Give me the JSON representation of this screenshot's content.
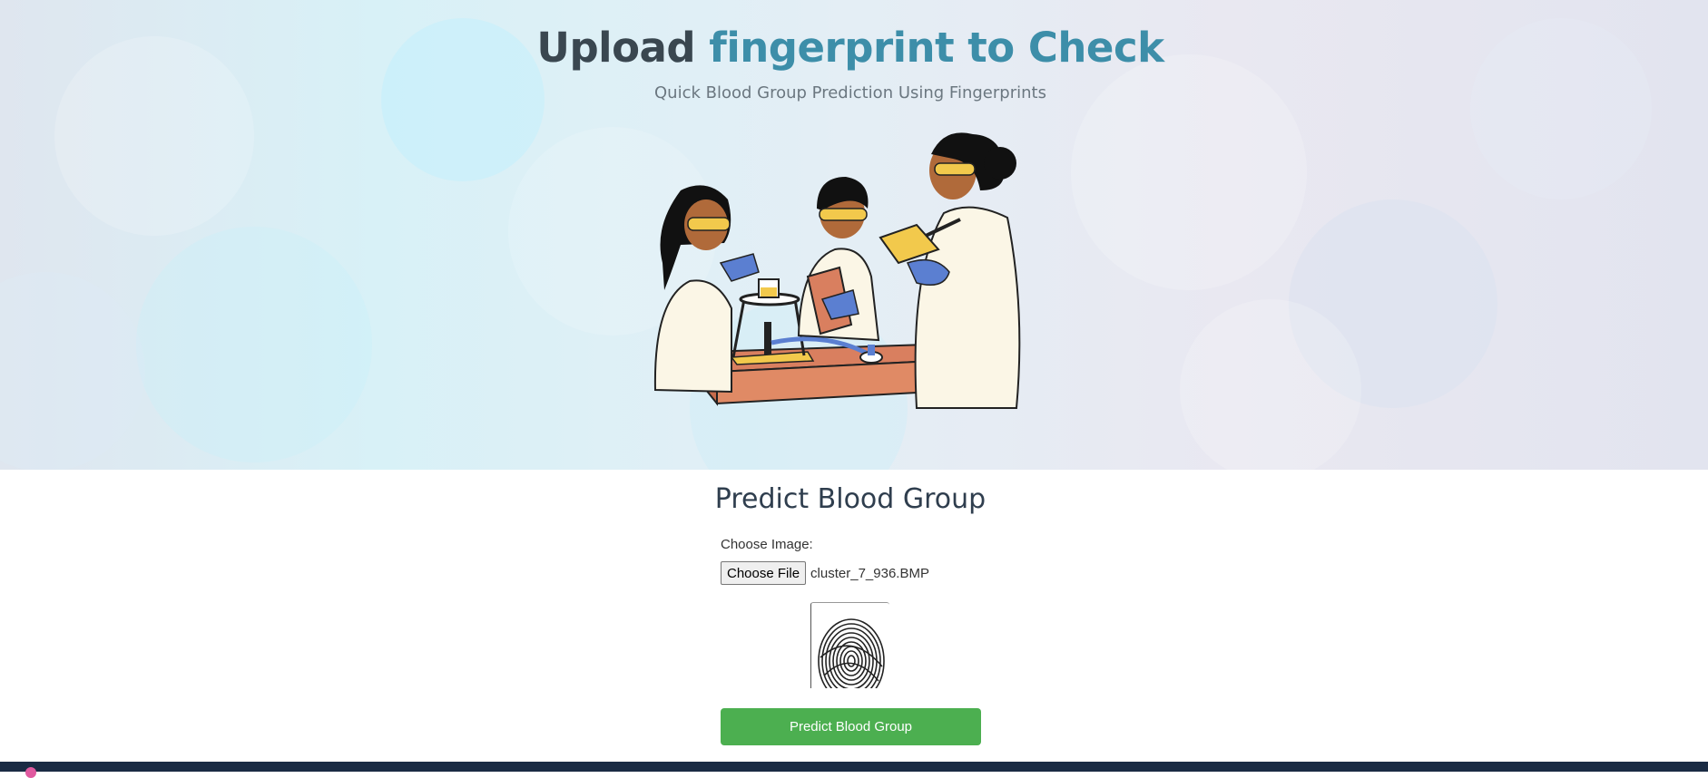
{
  "hero": {
    "title_part1": "Upload ",
    "title_part2": "fingerprint to Check",
    "subtitle": "Quick Blood Group Prediction Using Fingerprints",
    "colors": {
      "title_dark": "#3a4750",
      "title_accent": "#3d8ea9"
    },
    "illustration_icon": "scientists-lab-illustration"
  },
  "form": {
    "title": "Predict Blood Group",
    "choose_label": "Choose Image:",
    "file_button_label": "Choose File",
    "file_name": "cluster_7_936.BMP",
    "preview_icon": "fingerprint-preview",
    "submit_label": "Predict Blood Group",
    "submit_color": "#4caf50"
  }
}
